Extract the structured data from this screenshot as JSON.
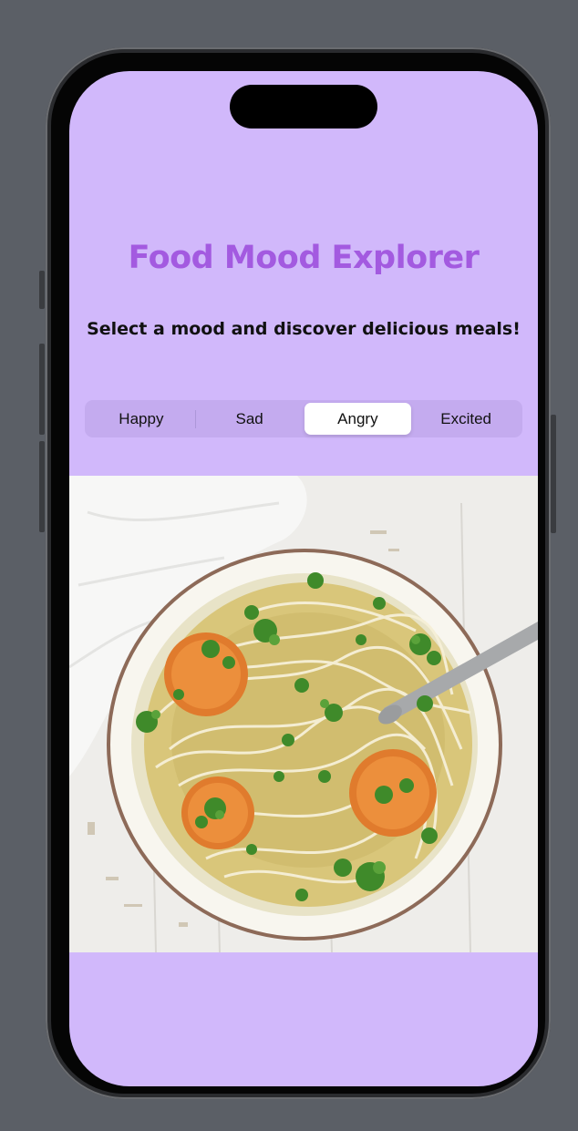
{
  "app": {
    "title": "Food Mood Explorer",
    "subtitle": "Select a mood and discover delicious meals!"
  },
  "moods": {
    "items": [
      "Happy",
      "Sad",
      "Angry",
      "Excited"
    ],
    "selected": "Angry"
  },
  "meal_image": {
    "description_icon": "noodle-soup-image"
  },
  "colors": {
    "background": "#d1b8fb",
    "title": "#a35ae0",
    "segment_track": "#c4abef",
    "segment_selected": "#ffffff"
  }
}
